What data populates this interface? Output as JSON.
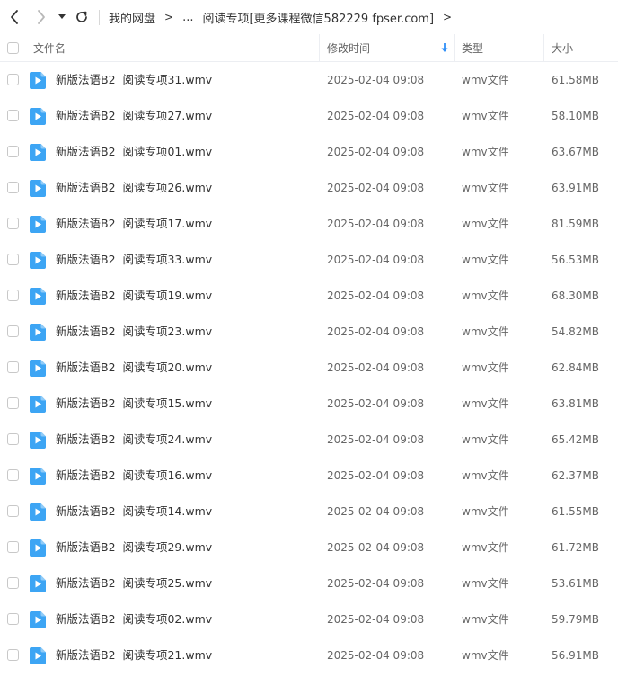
{
  "nav": {
    "back_icon": "chevron-left-icon",
    "forward_icon": "chevron-right-icon",
    "history_icon": "caret-down-icon",
    "refresh_icon": "refresh-icon",
    "breadcrumb": {
      "root": "我的网盘",
      "ellipsis": "...",
      "current": "阅读专项[更多课程微信582229 fpser.com]",
      "separator": ">"
    }
  },
  "table": {
    "columns": {
      "name": "文件名",
      "modified": "修改时间",
      "type": "类型",
      "size": "大小"
    },
    "sort_icon": "arrow-down-icon",
    "sort_color": "#2f8ff7",
    "file_icon_color": "#3da5f4",
    "rows": [
      {
        "name": "新版法语B2  阅读专项31.wmv",
        "date": "2025-02-04 09:08",
        "type": "wmv文件",
        "size": "61.58MB"
      },
      {
        "name": "新版法语B2  阅读专项27.wmv",
        "date": "2025-02-04 09:08",
        "type": "wmv文件",
        "size": "58.10MB"
      },
      {
        "name": "新版法语B2  阅读专项01.wmv",
        "date": "2025-02-04 09:08",
        "type": "wmv文件",
        "size": "63.67MB"
      },
      {
        "name": "新版法语B2  阅读专项26.wmv",
        "date": "2025-02-04 09:08",
        "type": "wmv文件",
        "size": "63.91MB"
      },
      {
        "name": "新版法语B2  阅读专项17.wmv",
        "date": "2025-02-04 09:08",
        "type": "wmv文件",
        "size": "81.59MB"
      },
      {
        "name": "新版法语B2  阅读专项33.wmv",
        "date": "2025-02-04 09:08",
        "type": "wmv文件",
        "size": "56.53MB"
      },
      {
        "name": "新版法语B2  阅读专项19.wmv",
        "date": "2025-02-04 09:08",
        "type": "wmv文件",
        "size": "68.30MB"
      },
      {
        "name": "新版法语B2  阅读专项23.wmv",
        "date": "2025-02-04 09:08",
        "type": "wmv文件",
        "size": "54.82MB"
      },
      {
        "name": "新版法语B2  阅读专项20.wmv",
        "date": "2025-02-04 09:08",
        "type": "wmv文件",
        "size": "62.84MB"
      },
      {
        "name": "新版法语B2  阅读专项15.wmv",
        "date": "2025-02-04 09:08",
        "type": "wmv文件",
        "size": "63.81MB"
      },
      {
        "name": "新版法语B2  阅读专项24.wmv",
        "date": "2025-02-04 09:08",
        "type": "wmv文件",
        "size": "65.42MB"
      },
      {
        "name": "新版法语B2  阅读专项16.wmv",
        "date": "2025-02-04 09:08",
        "type": "wmv文件",
        "size": "62.37MB"
      },
      {
        "name": "新版法语B2  阅读专项14.wmv",
        "date": "2025-02-04 09:08",
        "type": "wmv文件",
        "size": "61.55MB"
      },
      {
        "name": "新版法语B2  阅读专项29.wmv",
        "date": "2025-02-04 09:08",
        "type": "wmv文件",
        "size": "61.72MB"
      },
      {
        "name": "新版法语B2  阅读专项25.wmv",
        "date": "2025-02-04 09:08",
        "type": "wmv文件",
        "size": "53.61MB"
      },
      {
        "name": "新版法语B2  阅读专项02.wmv",
        "date": "2025-02-04 09:08",
        "type": "wmv文件",
        "size": "59.79MB"
      },
      {
        "name": "新版法语B2  阅读专项21.wmv",
        "date": "2025-02-04 09:08",
        "type": "wmv文件",
        "size": "56.91MB"
      }
    ]
  }
}
